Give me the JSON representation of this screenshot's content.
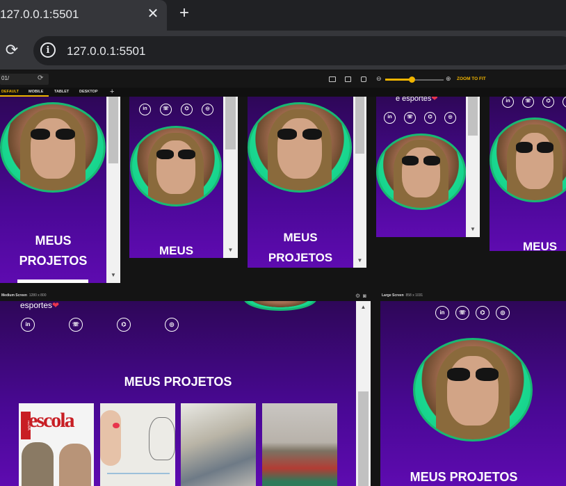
{
  "browser": {
    "tab_title": "127.0.0.1:5501",
    "close_glyph": "✕",
    "new_tab_glyph": "+",
    "url": "127.0.0.1:5501"
  },
  "responsive_viewer": {
    "url_input_value": "01/",
    "zoom_label": "ZOOM TO FIT",
    "zoom_level": 0.45,
    "tabs": [
      "DEFAULT",
      "MOBILE",
      "TABLET",
      "DESKTOP"
    ],
    "add_tab_glyph": "+",
    "medium_label": "Medium Screen",
    "medium_size": "1280 x 800",
    "large_label": "Large Screen",
    "large_size": "858 x 1031"
  },
  "page": {
    "section_title": "MEUS PROJETOS",
    "title_line1": "MEUS",
    "title_line2": "PROJETOS",
    "bio_tail": "e esportes",
    "bio_tail_short": "esportes",
    "heart_glyph": "❤",
    "social": [
      "in",
      "☏",
      "⌬",
      "◎"
    ],
    "project_cover_text": "escola",
    "project_cover_badge": "NOVA"
  },
  "icons": {
    "reload": "⟳",
    "info": "i",
    "arrow_up": "▲",
    "arrow_down": "▼",
    "zoom_out": "⊖",
    "zoom_in": "⊕"
  }
}
